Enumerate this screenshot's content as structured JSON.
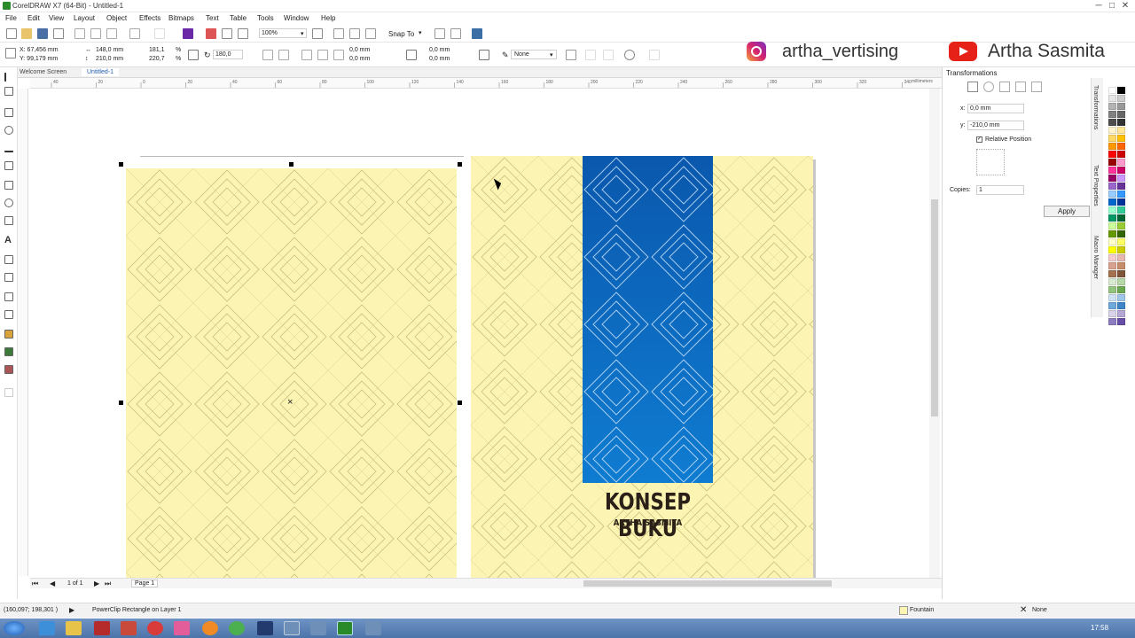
{
  "window": {
    "title": "CorelDRAW X7 (64-Bit) - Untitled-1",
    "minimize": "─",
    "maximize": "□",
    "close": "✕"
  },
  "menu": [
    "File",
    "Edit",
    "View",
    "Layout",
    "Object",
    "Effects",
    "Bitmaps",
    "Text",
    "Table",
    "Tools",
    "Window",
    "Help"
  ],
  "toolbar": {
    "zoom": "100%",
    "snap_to": "Snap To"
  },
  "properties": {
    "x": "X: 67,456 mm",
    "y": "Y: 99,179 mm",
    "width": "148,0 mm",
    "height": "210,0 mm",
    "scale_w": "181,1",
    "scale_h": "220,7",
    "percent": "%",
    "rotation": "180,0",
    "offset_x1": "0,0 mm",
    "offset_y1": "0,0 mm",
    "offset_x2": "0,0 mm",
    "offset_y2": "0,0 mm",
    "outline": "None"
  },
  "social": {
    "instagram": "artha_vertising",
    "youtube": "Artha Sasmita"
  },
  "tabs": [
    {
      "label": "Welcome Screen"
    },
    {
      "label": "Untitled-1"
    }
  ],
  "ruler": {
    "ticks": [
      "40",
      "20",
      "0",
      "20",
      "40",
      "60",
      "80",
      "100",
      "120",
      "140",
      "160",
      "180",
      "200",
      "220",
      "240",
      "260",
      "280",
      "300",
      "320",
      "340"
    ],
    "unit": "millimeters"
  },
  "cover": {
    "title": "KONSEP BUKU",
    "subtitle": "ARTHA SASMITA"
  },
  "pagenav": {
    "count": "1 of 1",
    "page": "Page 1"
  },
  "docker": {
    "title": "Transformations",
    "x_label": "x:",
    "x_value": "0,0 mm",
    "y_label": "y:",
    "y_value": "-210,0 mm",
    "relative": "Relative Position",
    "copies_label": "Copies:",
    "copies_value": "1",
    "apply": "Apply",
    "side_tabs": [
      "Transformations",
      "Text Properties",
      "Macro Manager"
    ]
  },
  "status": {
    "coords": "(160,097; 198,301 )",
    "message": "PowerClip Rectangle on Layer 1",
    "fill": "Fountain",
    "outline": "None",
    "clock": "17:58"
  },
  "colors": {
    "page": "#fbf4b2",
    "panel_top": "#0a58ad",
    "panel_bottom": "#0f7cd1",
    "accent": "#1e5bb0"
  },
  "palette": [
    "#ffffff",
    "#000000",
    "#e6e6e6",
    "#cccccc",
    "#b3b3b3",
    "#999999",
    "#808080",
    "#666666",
    "#4d4d4d",
    "#333333",
    "#fff2cc",
    "#ffe699",
    "#ffd966",
    "#ffc000",
    "#ff9900",
    "#ff6600",
    "#ff0000",
    "#cc0000",
    "#990000",
    "#ff99cc",
    "#ff3399",
    "#cc0066",
    "#990066",
    "#cc99ff",
    "#9966cc",
    "#663399",
    "#99ccff",
    "#3399ff",
    "#0066cc",
    "#003399",
    "#99ffcc",
    "#33cc99",
    "#009966",
    "#006633",
    "#ccff99",
    "#99cc33",
    "#669900",
    "#336600",
    "#ffffcc",
    "#ffff66",
    "#ffff00",
    "#cccc00",
    "#f4cccc",
    "#e6b8af",
    "#d9a18f",
    "#c78d6b",
    "#a5714f",
    "#7f5539",
    "#d9ead3",
    "#b6d7a8",
    "#93c47d",
    "#6aa84f",
    "#cfe2f3",
    "#9fc5e8",
    "#6fa8dc",
    "#3d85c6",
    "#d9d2e9",
    "#b4a7d6",
    "#8e7cc3",
    "#674ea7"
  ]
}
